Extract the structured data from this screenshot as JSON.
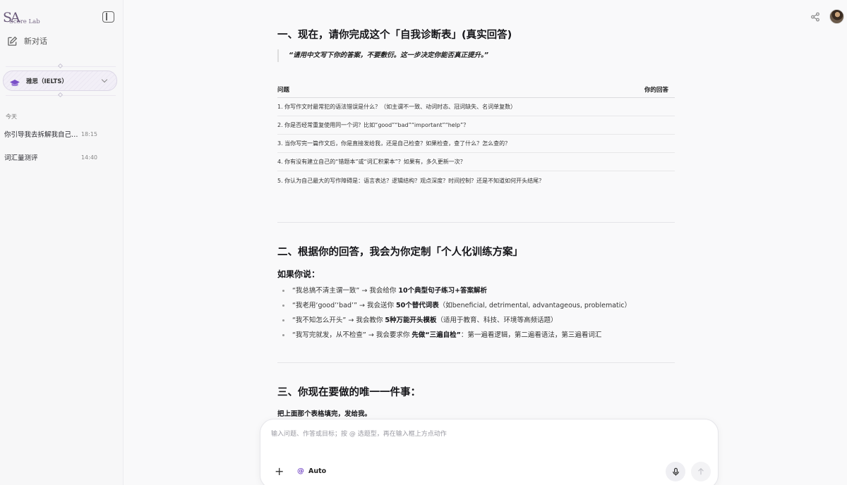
{
  "sidebar": {
    "logo_big": "SA",
    "logo_small": "Score Lab",
    "new_chat_label": "新对话",
    "subject_label": "雅思（IELTS）",
    "today_label": "今天",
    "history": [
      {
        "title": "你引导我去拆解我自己写作的问题",
        "time": "18:15"
      },
      {
        "title": "词汇量测评",
        "time": "14:40"
      }
    ]
  },
  "content": {
    "section1_title": "一、现在，请你完成这个「自我诊断表」(真实回答)",
    "quote": "“请用中文写下你的答案，不要敷衍。这一步决定你能否真正提升。”",
    "table": {
      "col_question": "问题",
      "col_answer": "你的回答",
      "rows": [
        "1. 你写作文时最常犯的语法错误是什么？（如主谓不一致、动词时态、冠词缺失、名词单复数）",
        "2. 你是否经常重复使用同一个词？比如“good”“bad”“important”“help”？",
        "3. 当你写完一篇作文后，你是直接发给我，还是自己检查？如果检查，查了什么？怎么查的？",
        "4. 你有没有建立自己的“错题本”或“词汇积累本”？如果有，多久更新一次？",
        "5. 你认为自己最大的写作障碍是：语言表达？逻辑结构？观点深度？时间控制？还是不知道如何开头结尾？"
      ]
    },
    "section2_title": "二、根据你的回答，我会为你定制「个人化训练方案」",
    "if_you_say": "如果你说：",
    "bullets": [
      {
        "pre": "“我总搞不清主谓一致” → 我会给你 ",
        "bold": "10个典型句子练习+答案解析",
        "post": ""
      },
      {
        "pre": "“我老用‘good’‘bad’” → 我会送你 ",
        "bold": "50个替代词表",
        "post": "（如beneficial, detrimental, advantageous, problematic）"
      },
      {
        "pre": "“我不知怎么开头” → 我会教你 ",
        "bold": "5种万能开头模板",
        "post": "（适用于教育、科技、环境等高频话题）"
      },
      {
        "pre": "“我写完就发，从不检查” → 我会要求你 ",
        "bold": "先做“三遍自检”",
        "post": "：第一遍看逻辑，第二遍看语法，第三遍看词汇"
      }
    ],
    "section3_title": "三、你现在要做的唯一一件事：",
    "final_instruction": "把上面那个表格填完，发给我。"
  },
  "composer": {
    "placeholder": "输入问题、作答或目标；按 @ 选题型，再在输入框上方点动作",
    "at_symbol": "@",
    "mode_label": "Auto",
    "plus": "+"
  },
  "colors": {
    "accent": "#7a4fc8"
  }
}
